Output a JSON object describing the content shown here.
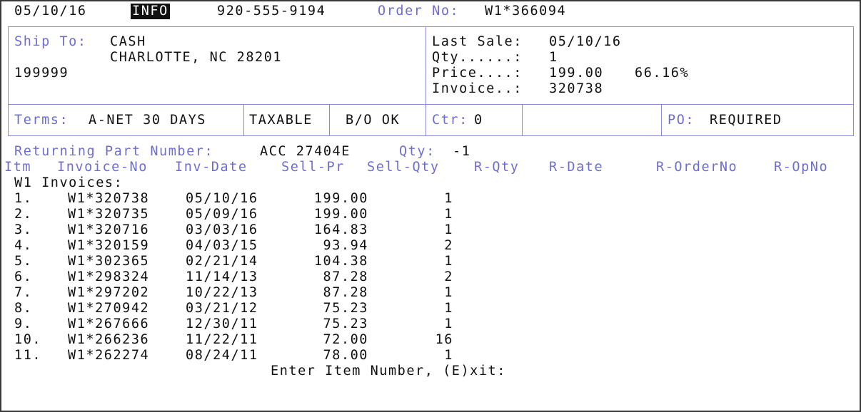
{
  "header": {
    "date": "05/10/16",
    "mode": "INFO",
    "phone": "920-555-9194",
    "order_label": "Order No:",
    "order_no": "W1*366094"
  },
  "ship_to": {
    "label": "Ship To:",
    "name": "CASH",
    "city_line": "CHARLOTTE, NC 28201",
    "account": "199999"
  },
  "last_sale": {
    "date_label": "Last Sale:",
    "date": "05/10/16",
    "qty_label": "Qty......:",
    "qty": "1",
    "price_label": "Price....:",
    "price": "199.00",
    "margin": "66.16%",
    "invoice_label": "Invoice..:",
    "invoice": "320738"
  },
  "terms_bar": {
    "terms_label": "Terms:",
    "terms": "A-NET 30 DAYS",
    "taxable": "TAXABLE",
    "bo": "B/O OK",
    "ctr_label": "Ctr:",
    "ctr": "0",
    "po_label": "PO:",
    "po": "REQUIRED"
  },
  "returning": {
    "label": "Returning Part Number:",
    "part": "ACC 27404E",
    "qty_label": "Qty:",
    "qty": "-1"
  },
  "columns": [
    "Itm",
    "Invoice-No",
    "Inv-Date",
    "Sell-Pr",
    "Sell-Qty",
    "R-Qty",
    "R-Date",
    "R-OrderNo",
    "R-OpNo"
  ],
  "group_label": "W1 Invoices:",
  "rows": [
    {
      "itm": "1.",
      "invoice": "W1*320738",
      "date": "05/10/16",
      "price": "199.00",
      "qty": "1"
    },
    {
      "itm": "2.",
      "invoice": "W1*320735",
      "date": "05/09/16",
      "price": "199.00",
      "qty": "1"
    },
    {
      "itm": "3.",
      "invoice": "W1*320716",
      "date": "03/03/16",
      "price": "164.83",
      "qty": "1"
    },
    {
      "itm": "4.",
      "invoice": "W1*320159",
      "date": "04/03/15",
      "price": "93.94",
      "qty": "2"
    },
    {
      "itm": "5.",
      "invoice": "W1*302365",
      "date": "02/21/14",
      "price": "104.38",
      "qty": "1"
    },
    {
      "itm": "6.",
      "invoice": "W1*298324",
      "date": "11/14/13",
      "price": "87.28",
      "qty": "2"
    },
    {
      "itm": "7.",
      "invoice": "W1*297202",
      "date": "10/22/13",
      "price": "87.28",
      "qty": "1"
    },
    {
      "itm": "8.",
      "invoice": "W1*270942",
      "date": "03/21/12",
      "price": "75.23",
      "qty": "1"
    },
    {
      "itm": "9.",
      "invoice": "W1*267666",
      "date": "12/30/11",
      "price": "75.23",
      "qty": "1"
    },
    {
      "itm": "10.",
      "invoice": "W1*266236",
      "date": "11/22/11",
      "price": "72.00",
      "qty": "16"
    },
    {
      "itm": "11.",
      "invoice": "W1*262274",
      "date": "08/24/11",
      "price": "78.00",
      "qty": "1"
    }
  ],
  "prompt": "Enter Item Number, (E)xit:"
}
